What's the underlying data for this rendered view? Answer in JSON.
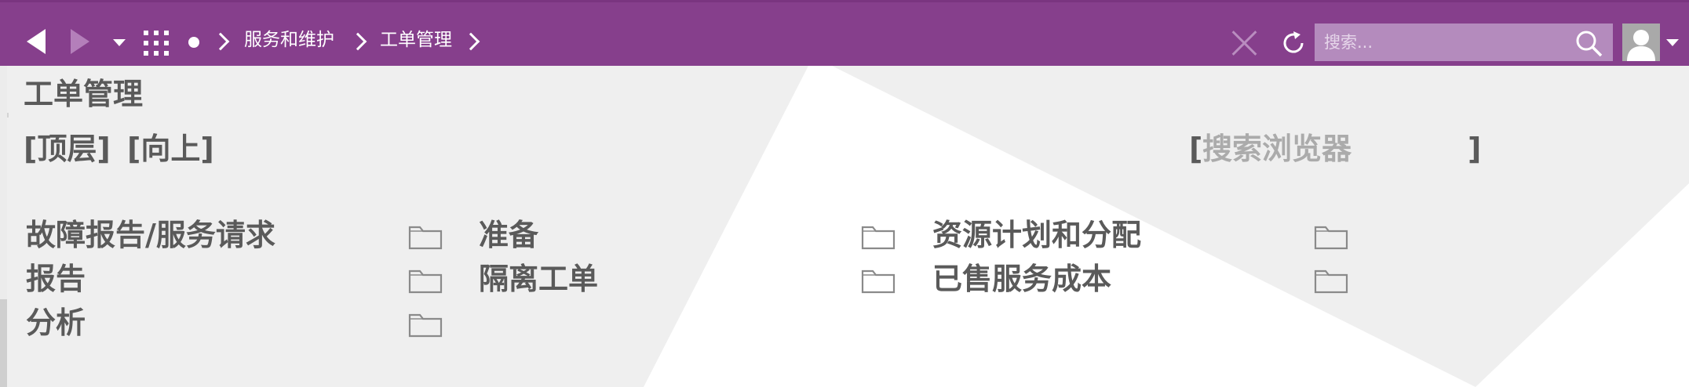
{
  "toolbar": {
    "back_icon": "arrow-left-icon",
    "forward_icon": "arrow-right-icon",
    "history_dropdown_icon": "caret-down-icon",
    "apps_icon": "grid-icon",
    "home_icon": "dot-icon",
    "breadcrumbs": [
      "服务和维护",
      "工单管理"
    ],
    "clear_icon": "close-icon",
    "refresh_icon": "refresh-icon",
    "search_placeholder": "搜索...",
    "search_icon": "search-icon",
    "user_icon": "avatar-icon",
    "user_dropdown_icon": "caret-down-icon",
    "colors": {
      "bar": "#863f8c",
      "search_bg": "#b48bbd",
      "inactive": "#b47fba"
    }
  },
  "page": {
    "title": "工单管理",
    "link_top": "[顶层]",
    "link_up": "[向上]",
    "browser_search_open": "[",
    "browser_search_label": "搜索浏览器",
    "browser_search_close": "]"
  },
  "items": [
    {
      "label": "故障报告/服务请求",
      "icon": "folder-icon"
    },
    {
      "label": "准备",
      "icon": "folder-icon"
    },
    {
      "label": "资源计划和分配",
      "icon": "folder-icon"
    },
    {
      "label": "报告",
      "icon": "folder-icon"
    },
    {
      "label": "隔离工单",
      "icon": "folder-icon"
    },
    {
      "label": "已售服务成本",
      "icon": "folder-icon"
    },
    {
      "label": "分析",
      "icon": "folder-icon"
    }
  ],
  "colors": {
    "text": "#5a5a5a",
    "muted": "#ababab"
  }
}
